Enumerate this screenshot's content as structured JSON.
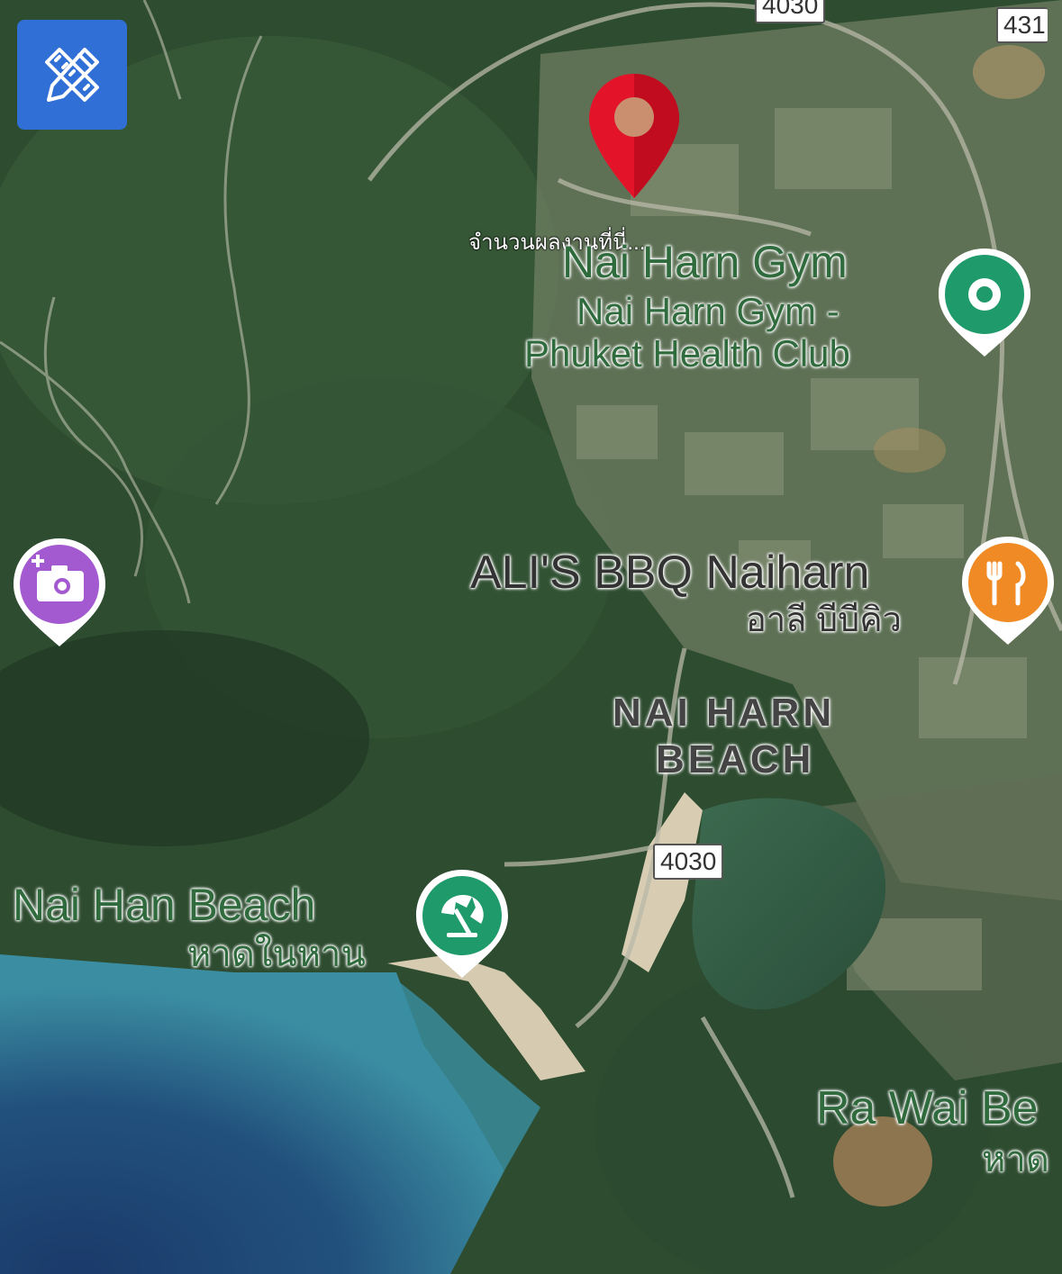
{
  "colors": {
    "vegetation_dark": "#23402a",
    "vegetation": "#3b5e3a",
    "urban": "#7d8a6e",
    "sand": "#d8cdb3",
    "sea_light": "#3a8fa3",
    "sea_deep": "#1c3f6e",
    "road": "#b8b8a8",
    "poi_green": "#1f9a6a",
    "poi_orange": "#f08a24",
    "poi_purple": "#a35ad0",
    "marker_red": "#e3142a",
    "tool_button": "#2f6fd6"
  },
  "toolbar": {
    "edit_icon": "pencil-ruler-icon"
  },
  "marker": {
    "icon": "location-pin-icon",
    "caption": "จำนวนผลงานที่นี่..."
  },
  "labels": {
    "gym_short": "Nai Harn Gym",
    "gym_full_1": "Nai Harn Gym -",
    "gym_full_2": "Phuket Health Club",
    "bbq": "ALI'S BBQ Naiharn",
    "bbq_thai": "อาลี บีบีคิว",
    "area_1": "NAI HARN",
    "area_2": "BEACH",
    "beach": "Nai Han Beach",
    "beach_thai": "หาดในหาน",
    "rawai": "Ra Wai Be",
    "rawai_thai": "หาด"
  },
  "road_shields": {
    "top": "4030",
    "top_right": "431",
    "middle": "4030"
  },
  "pois": [
    {
      "name": "gym",
      "icon": "dumbbell-dot-icon",
      "color": "#1f9a6a"
    },
    {
      "name": "restaurant",
      "icon": "fork-knife-icon",
      "color": "#f08a24"
    },
    {
      "name": "photo-spot",
      "icon": "camera-plus-icon",
      "color": "#a35ad0"
    },
    {
      "name": "beach",
      "icon": "beach-umbrella-icon",
      "color": "#1f9a6a"
    }
  ]
}
